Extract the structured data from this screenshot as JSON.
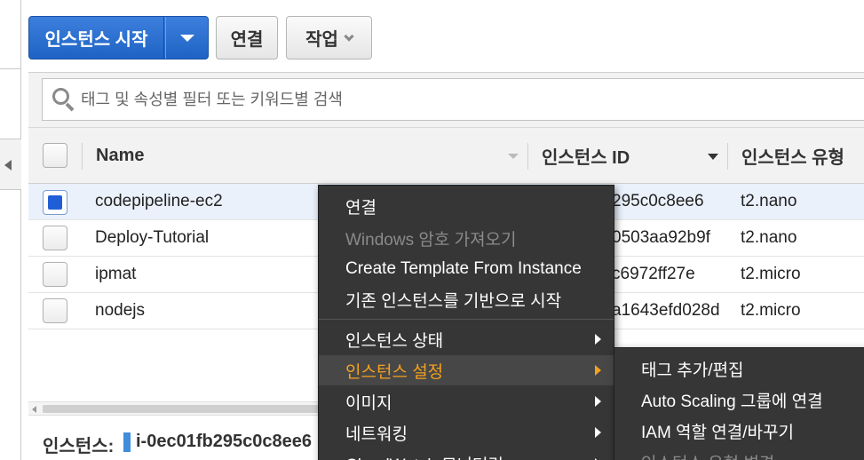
{
  "toolbar": {
    "launch_label": "인스턴스 시작",
    "connect_label": "연결",
    "actions_label": "작업"
  },
  "search": {
    "placeholder": "태그 및 속성별 필터 또는 키워드별 검색"
  },
  "table": {
    "columns": [
      "Name",
      "인스턴스 ID",
      "인스턴스 유형"
    ],
    "rows": [
      {
        "name": "codepipeline-ec2",
        "instance_id": "i-0ec01fb295c0c8ee6",
        "id_visible": "295c0c8ee6",
        "type": "t2.nano",
        "selected": true
      },
      {
        "name": "Deploy-Tutorial",
        "id_visible": "0503aa92b9f",
        "type": "t2.nano",
        "selected": false
      },
      {
        "name": "ipmat",
        "id_visible": "c6972ff27e",
        "type": "t2.micro",
        "selected": false
      },
      {
        "name": "nodejs",
        "id_visible": "a1643efd028d",
        "type": "t2.micro",
        "selected": false
      }
    ]
  },
  "details": {
    "label": "인스턴스:",
    "value": "i-0ec01fb295c0c8ee6"
  },
  "context_menu": {
    "items": [
      {
        "label": "연결",
        "enabled": true
      },
      {
        "label": "Windows 암호 가져오기",
        "enabled": false
      },
      {
        "label": "Create Template From Instance",
        "enabled": true
      },
      {
        "label": "기존 인스턴스를 기반으로 시작",
        "enabled": true
      },
      {
        "label": "인스턴스 상태",
        "submenu": true
      },
      {
        "label": "인스턴스 설정",
        "submenu": true,
        "active": true
      },
      {
        "label": "이미지",
        "submenu": true
      },
      {
        "label": "네트워킹",
        "submenu": true
      },
      {
        "label": "CloudWatch 모니터링",
        "submenu": true
      }
    ]
  },
  "sub_menu": {
    "items": [
      {
        "label": "태그 추가/편집",
        "enabled": true
      },
      {
        "label": "Auto Scaling 그룹에 연결",
        "enabled": true
      },
      {
        "label": "IAM 역할 연결/바꾸기",
        "enabled": true
      },
      {
        "label": "인스턴스 유형 변경",
        "enabled": false
      }
    ]
  },
  "colors": {
    "primary": "#1e63c4",
    "menu_bg": "#363636",
    "menu_active_text": "#f4a11f"
  }
}
